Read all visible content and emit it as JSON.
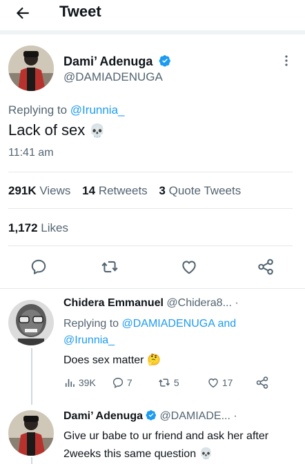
{
  "header": {
    "title": "Tweet"
  },
  "tweet": {
    "author_name": "Dami’ Adenuga",
    "author_handle": "@DAMIADENUGA",
    "replying_prefix": "Replying to",
    "replying_to": "@Irunnia_",
    "text": "Lack of sex",
    "emoji": "💀",
    "time": "11:41 am",
    "views_count": "291K",
    "views_label": "Views",
    "retweets_count": "14",
    "retweets_label": "Retweets",
    "quotes_count": "3",
    "quotes_label": "Quote Tweets",
    "likes_count": "1,172",
    "likes_label": "Likes"
  },
  "reply1": {
    "author_name": "Chidera Emmanuel",
    "author_handle": "@Chidera8...",
    "dot": "·",
    "replying_prefix": "Replying to",
    "replying_to_1": "@DAMIADENUGA",
    "replying_and": "and",
    "replying_to_2": "@Irunnia_",
    "text": "Does sex matter",
    "emoji": "🤔",
    "views": "39K",
    "replies": "7",
    "retweets": "5",
    "likes": "17"
  },
  "reply2": {
    "author_name": "Dami’ Adenuga",
    "author_handle": "@DAMIADE...",
    "dot": "·",
    "text": "Give ur babe to ur friend and ask her after 2weeks this same question",
    "emoji": "💀"
  },
  "colors": {
    "accent": "#1d9bf0",
    "muted": "#536471",
    "text": "#0f1419"
  }
}
